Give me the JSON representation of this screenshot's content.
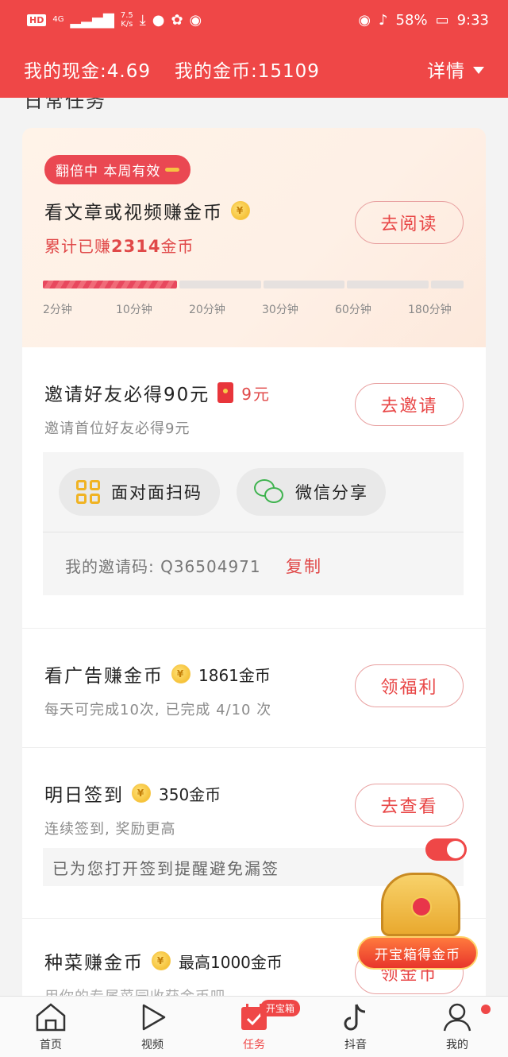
{
  "statusbar": {
    "hd": "HD",
    "signal": "4G",
    "speed_top": "7.5",
    "speed_bottom": "K/s",
    "battery": "58%",
    "time": "9:33"
  },
  "topbar": {
    "cash": "我的现金:4.69",
    "coins": "我的金币:15109",
    "detail": "详情"
  },
  "cut_title": "日常任务",
  "read_task": {
    "badge": "翻倍中 本周有效",
    "title": "看文章或视频赚金币",
    "earned_prefix": "累计已赚",
    "earned_value": "2314",
    "earned_suffix": "金币",
    "button": "去阅读",
    "progress": 0.286,
    "ticks": [
      "2分钟",
      "10分钟",
      "20分钟",
      "30分钟",
      "60分钟",
      "180分钟"
    ]
  },
  "invite_task": {
    "title": "邀请好友必得90元",
    "reward": "9元",
    "subtitle": "邀请首位好友必得9元",
    "button": "去邀请",
    "share_qr": "面对面扫码",
    "share_wechat": "微信分享",
    "code_label": "我的邀请码: Q36504971",
    "copy": "复制"
  },
  "ad_task": {
    "title": "看广告赚金币",
    "reward": "1861金币",
    "subtitle": "每天可完成10次, 已完成 4/10 次",
    "button": "领福利"
  },
  "sign_task": {
    "title": "明日签到",
    "reward": "350金币",
    "subtitle": "连续签到, 奖励更高",
    "button": "去查看",
    "remind": "已为您打开签到提醒避免漏签"
  },
  "veg_task": {
    "title": "种菜赚金币",
    "reward": "最高1000金币",
    "subtitle": "用你的专属菜园收获金币吧",
    "button": "领金币"
  },
  "chest": {
    "label": "开宝箱得金币"
  },
  "tabbar": {
    "home": "首页",
    "video": "视频",
    "task": "任务",
    "task_badge": "开宝箱",
    "douyin": "抖音",
    "mine": "我的"
  },
  "colors": {
    "brand": "#ef4747",
    "accent_text": "#e04848"
  }
}
